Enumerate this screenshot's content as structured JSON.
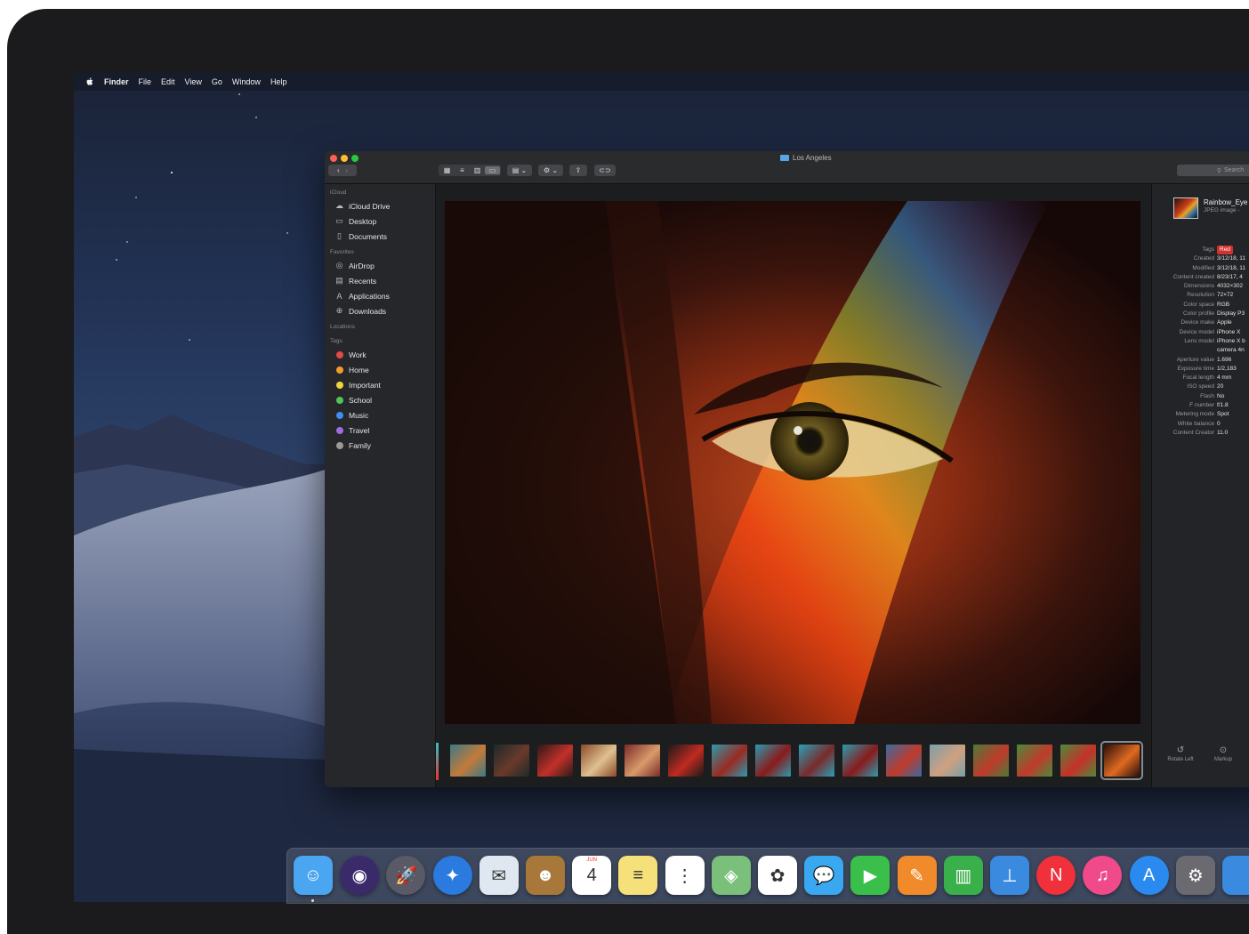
{
  "menubar": {
    "app_name": "Finder",
    "items": [
      "File",
      "Edit",
      "View",
      "Go",
      "Window",
      "Help"
    ]
  },
  "window": {
    "title": "Los Angeles",
    "search_placeholder": "Search"
  },
  "sidebar": {
    "sections": [
      {
        "header": "iCloud",
        "items": [
          {
            "label": "iCloud Drive",
            "icon": "cloud-icon"
          },
          {
            "label": "Desktop",
            "icon": "desktop-icon"
          },
          {
            "label": "Documents",
            "icon": "documents-icon"
          }
        ]
      },
      {
        "header": "Favorites",
        "items": [
          {
            "label": "AirDrop",
            "icon": "airdrop-icon"
          },
          {
            "label": "Recents",
            "icon": "recents-icon"
          },
          {
            "label": "Applications",
            "icon": "applications-icon"
          },
          {
            "label": "Downloads",
            "icon": "downloads-icon"
          }
        ]
      },
      {
        "header": "Locations",
        "items": []
      }
    ],
    "tags_header": "Tags",
    "tags": [
      {
        "label": "Work",
        "color": "#e24a44"
      },
      {
        "label": "Home",
        "color": "#f39c2b"
      },
      {
        "label": "Important",
        "color": "#f2d43c"
      },
      {
        "label": "School",
        "color": "#4fc45a"
      },
      {
        "label": "Music",
        "color": "#3d8ef0"
      },
      {
        "label": "Travel",
        "color": "#9b6ee0"
      },
      {
        "label": "Family",
        "color": "#9a9a9a"
      }
    ]
  },
  "info": {
    "file_name": "Rainbow_Eye",
    "file_kind": "JPEG image -",
    "metadata": [
      {
        "key": "Tags",
        "value": "Red",
        "badge": true
      },
      {
        "key": "Created",
        "value": "3/12/18, 11"
      },
      {
        "key": "Modified",
        "value": "3/12/18, 11"
      },
      {
        "key": "Content created",
        "value": "8/23/17, 4"
      },
      {
        "key": "Dimensions",
        "value": "4032×302"
      },
      {
        "key": "Resolution",
        "value": "72×72"
      },
      {
        "key": "Color space",
        "value": "RGB"
      },
      {
        "key": "Color profile",
        "value": "Display P3"
      },
      {
        "key": "Device make",
        "value": "Apple"
      },
      {
        "key": "Device model",
        "value": "iPhone X"
      },
      {
        "key": "Lens model",
        "value": "iPhone X b"
      },
      {
        "key": "",
        "value": "camera 4n"
      },
      {
        "key": "Aperture value",
        "value": "1.696"
      },
      {
        "key": "Exposure time",
        "value": "1/2,183"
      },
      {
        "key": "Focal length",
        "value": "4 mm"
      },
      {
        "key": "ISO speed",
        "value": "20"
      },
      {
        "key": "Flash",
        "value": "No"
      },
      {
        "key": "F number",
        "value": "f/1.8"
      },
      {
        "key": "Metering mode",
        "value": "Spot"
      },
      {
        "key": "White balance",
        "value": "0"
      },
      {
        "key": "Content Creator",
        "value": "11.0"
      }
    ],
    "actions": [
      {
        "label": "Rotate Left",
        "icon": "rotate-left-icon"
      },
      {
        "label": "Markup",
        "icon": "markup-icon"
      }
    ]
  },
  "thumbnails": [
    {
      "colors": [
        "#3a7a86",
        "#c47a3a"
      ]
    },
    {
      "colors": [
        "#1c2a2a",
        "#6a3a2a"
      ]
    },
    {
      "colors": [
        "#2a1a18",
        "#c4302a"
      ]
    },
    {
      "colors": [
        "#8a4a2a",
        "#e0c090"
      ]
    },
    {
      "colors": [
        "#7a2a2a",
        "#d89a6a"
      ]
    },
    {
      "colors": [
        "#1a1a1a",
        "#c02a20"
      ]
    },
    {
      "colors": [
        "#2a9ab0",
        "#9a2a20"
      ]
    },
    {
      "colors": [
        "#2a9ab0",
        "#8a1a1a"
      ]
    },
    {
      "colors": [
        "#28a0b8",
        "#7a2a2a"
      ]
    },
    {
      "colors": [
        "#2a9ab0",
        "#8a1a1a"
      ]
    },
    {
      "colors": [
        "#3a6aa0",
        "#c03a2a"
      ]
    },
    {
      "colors": [
        "#7aa0a8",
        "#d0a080"
      ]
    },
    {
      "colors": [
        "#4a7a3a",
        "#c03a2a"
      ]
    },
    {
      "colors": [
        "#4a8a3a",
        "#c03a2a"
      ]
    },
    {
      "colors": [
        "#4a8a3a",
        "#c8302a"
      ]
    },
    {
      "colors": [
        "#2a0e0a",
        "#e06a20"
      ]
    }
  ],
  "dock": {
    "apps": [
      {
        "name": "finder-icon",
        "bg": "#4aa6f0",
        "glyph": "☺"
      },
      {
        "name": "siri-icon",
        "bg": "#3a2a6a",
        "glyph": "◉"
      },
      {
        "name": "launchpad-icon",
        "bg": "#5a5a66",
        "glyph": "🚀"
      },
      {
        "name": "safari-icon",
        "bg": "#2a7ae0",
        "glyph": "✦"
      },
      {
        "name": "mail-icon",
        "bg": "#dfe8f0",
        "glyph": "✉"
      },
      {
        "name": "contacts-icon",
        "bg": "#a8783a",
        "glyph": "☻"
      },
      {
        "name": "calendar-icon",
        "bg": "#ffffff",
        "glyph": "4",
        "month": "JUN"
      },
      {
        "name": "notes-icon",
        "bg": "#f6e07a",
        "glyph": "≡"
      },
      {
        "name": "reminders-icon",
        "bg": "#ffffff",
        "glyph": "⋮"
      },
      {
        "name": "maps-icon",
        "bg": "#7ac07a",
        "glyph": "◈"
      },
      {
        "name": "photos-icon",
        "bg": "#ffffff",
        "glyph": "✿"
      },
      {
        "name": "messages-icon",
        "bg": "#3aa8f0",
        "glyph": "💬"
      },
      {
        "name": "facetime-icon",
        "bg": "#3ac04a",
        "glyph": "▶"
      },
      {
        "name": "pages-icon",
        "bg": "#f08a2a",
        "glyph": "✎"
      },
      {
        "name": "numbers-icon",
        "bg": "#3ab04a",
        "glyph": "▥"
      },
      {
        "name": "keynote-icon",
        "bg": "#3a8ae0",
        "glyph": "⊥"
      },
      {
        "name": "news-icon",
        "bg": "#f0303a",
        "glyph": "N"
      },
      {
        "name": "itunes-icon",
        "bg": "#f04a8a",
        "glyph": "♫"
      },
      {
        "name": "app-store-icon",
        "bg": "#2a8af0",
        "glyph": "A"
      },
      {
        "name": "system-preferences-icon",
        "bg": "#6a6a70",
        "glyph": "⚙"
      },
      {
        "name": "downloads-stack-icon",
        "bg": "#3a8ae0",
        "glyph": ""
      }
    ]
  }
}
